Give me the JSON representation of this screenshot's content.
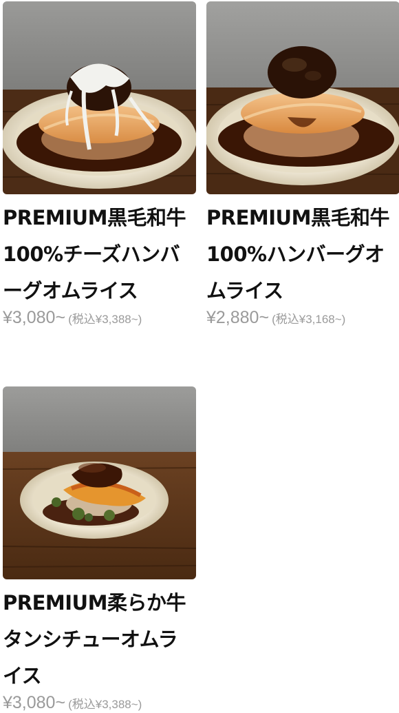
{
  "menu_items": [
    {
      "title": "PREMIUM黒毛和牛100%チーズハンバーグオムライス",
      "price": "¥3,080~",
      "tax_price": "(税込¥3,388~)"
    },
    {
      "title": "PREMIUM黒毛和牛100%ハンバーグオムライス",
      "price": "¥2,880~",
      "tax_price": "(税込¥3,168~)"
    },
    {
      "title": "PREMIUM柔らか牛タンシチューオムライス",
      "price": "¥3,080~",
      "tax_price": "(税込¥3,388~)"
    }
  ],
  "colors": {
    "price_gray": "#9a9a9a",
    "title_black": "#111111",
    "wall_gray": "#8f8f8d",
    "table_wood": "#5a3519",
    "plate_cream": "#eae3cf",
    "demi_sauce": "#3a1605",
    "omelette": "#e9a961"
  }
}
